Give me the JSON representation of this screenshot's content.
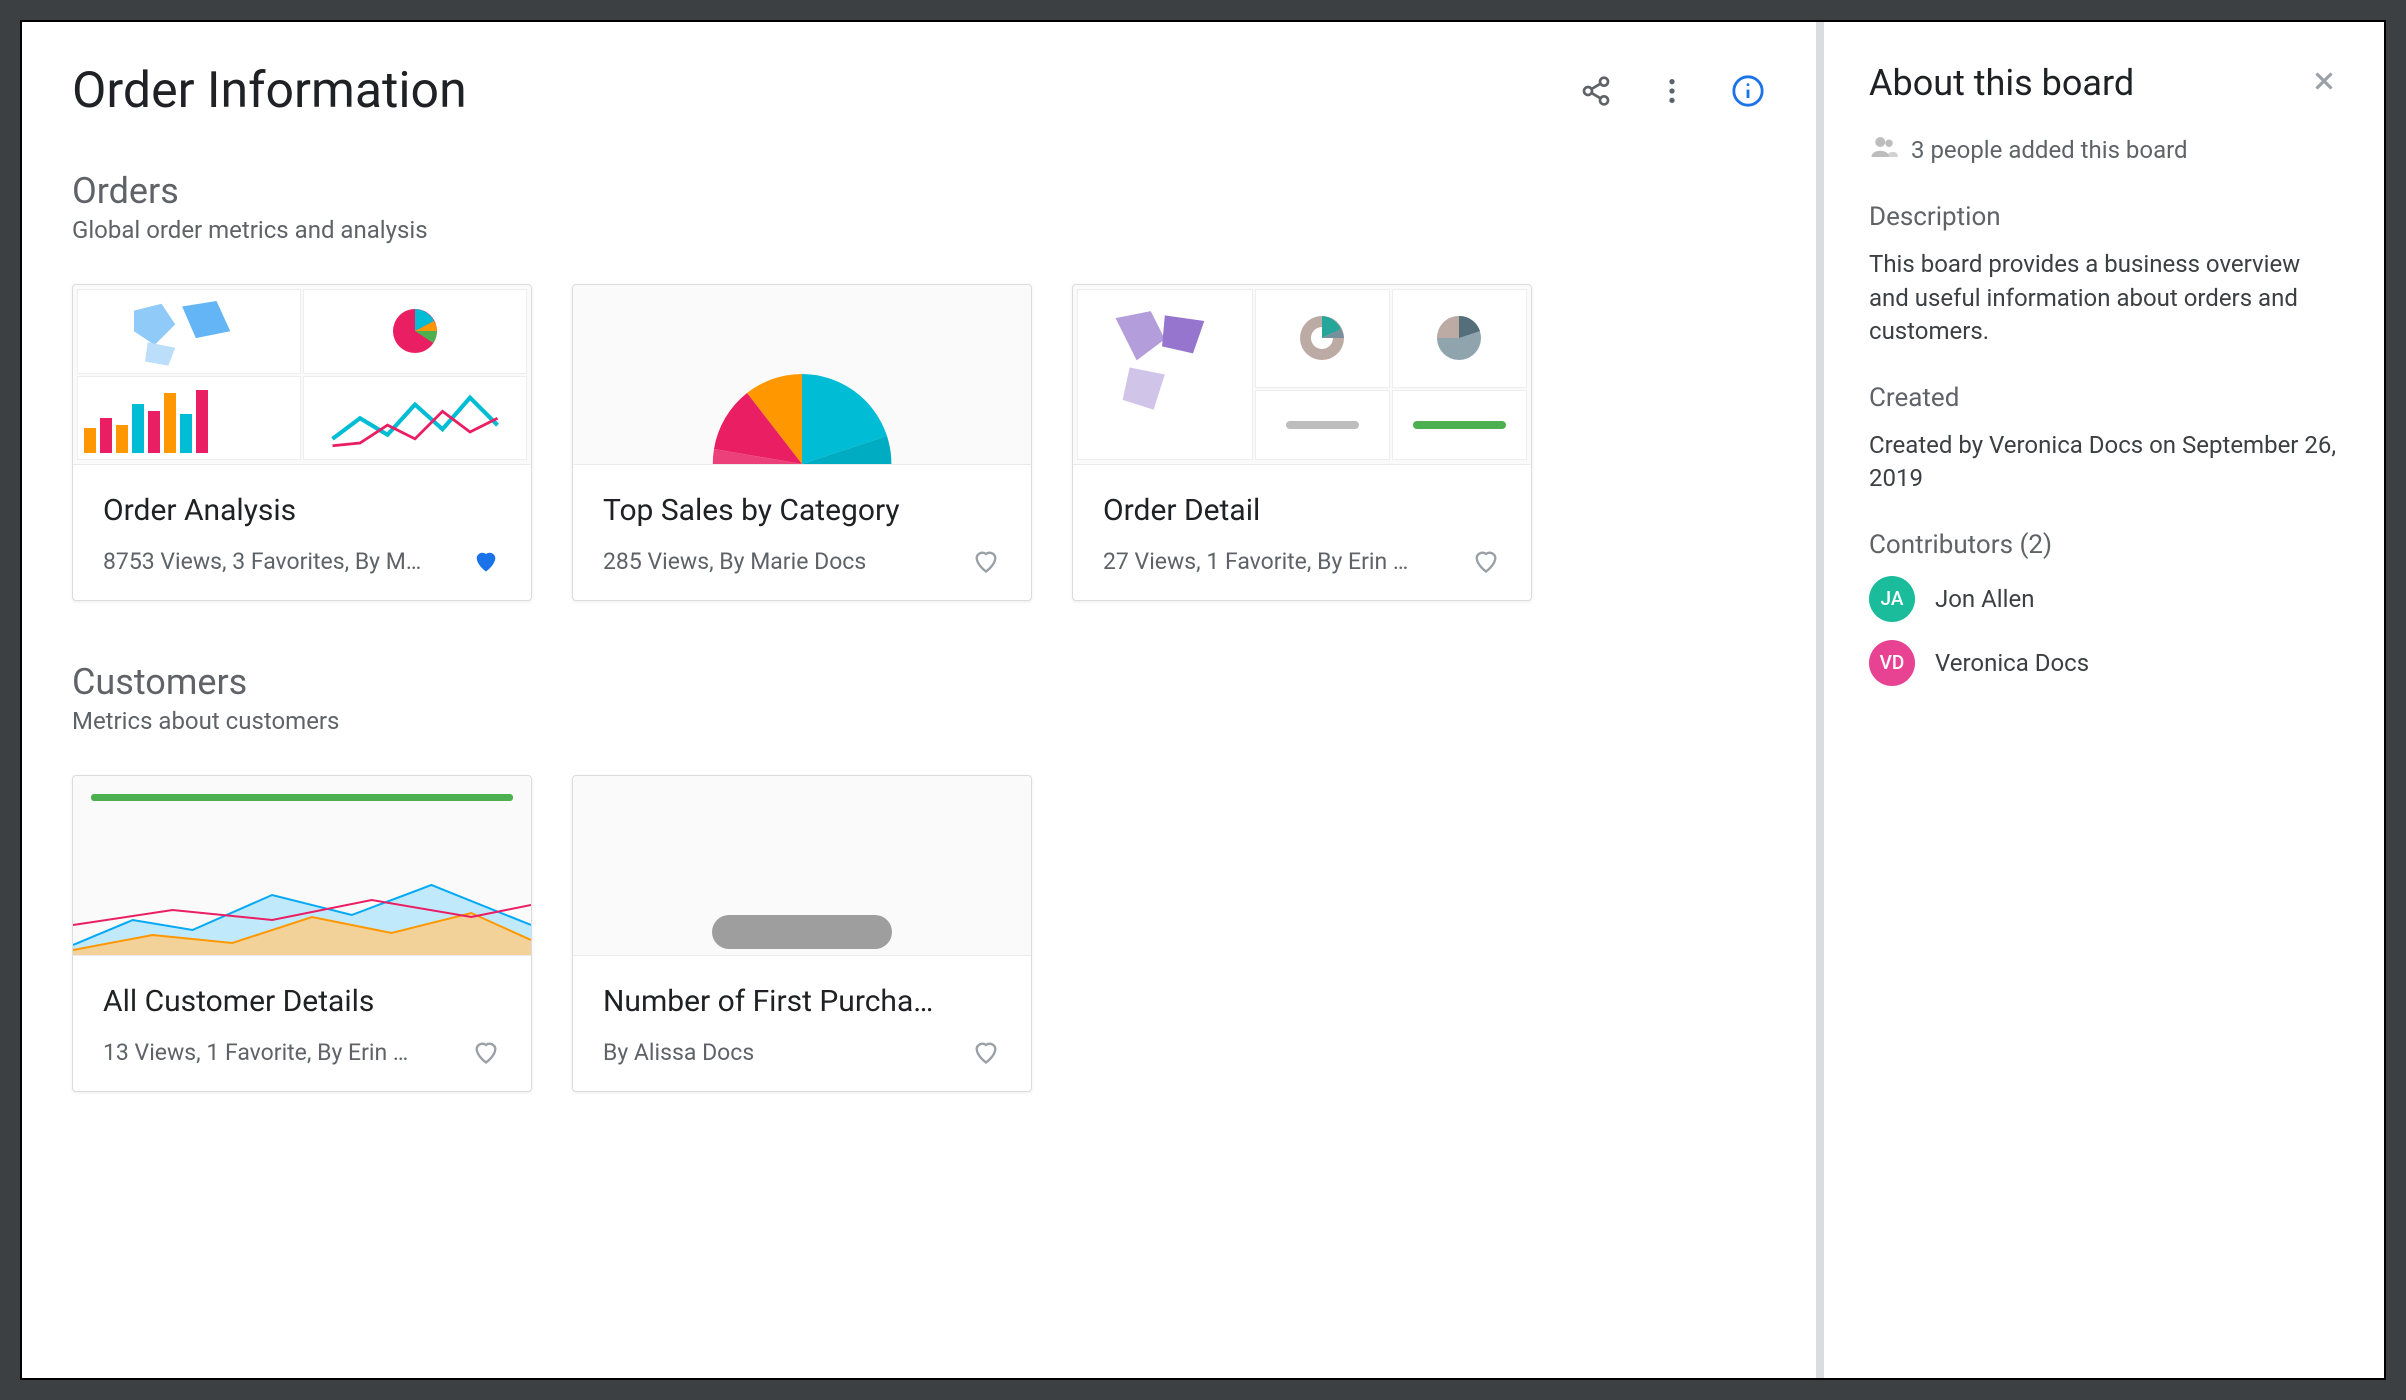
{
  "header": {
    "title": "Order Information"
  },
  "sections": [
    {
      "title": "Orders",
      "subtitle": "Global order metrics and analysis",
      "cards": [
        {
          "title": "Order Analysis",
          "meta": "8753 Views, 3 Favorites, By M…",
          "favorited": true
        },
        {
          "title": "Top Sales by Category",
          "meta": "285 Views, By Marie Docs",
          "favorited": false
        },
        {
          "title": "Order Detail",
          "meta": "27 Views, 1 Favorite, By Erin …",
          "favorited": false
        }
      ]
    },
    {
      "title": "Customers",
      "subtitle": "Metrics about customers",
      "cards": [
        {
          "title": "All Customer Details",
          "meta": "13 Views, 1 Favorite, By Erin …",
          "favorited": false
        },
        {
          "title": "Number of First Purcha…",
          "meta": "By Alissa Docs",
          "favorited": false
        }
      ]
    }
  ],
  "about": {
    "title": "About this board",
    "people_added": "3 people added this board",
    "description_label": "Description",
    "description": "This board provides a business overview and useful information about orders and customers.",
    "created_label": "Created",
    "created": "Created by Veronica Docs on September 26, 2019",
    "contributors_label": "Contributors (2)",
    "contributors": [
      {
        "initials": "JA",
        "name": "Jon Allen",
        "color": "teal"
      },
      {
        "initials": "VD",
        "name": "Veronica Docs",
        "color": "pink"
      }
    ]
  }
}
